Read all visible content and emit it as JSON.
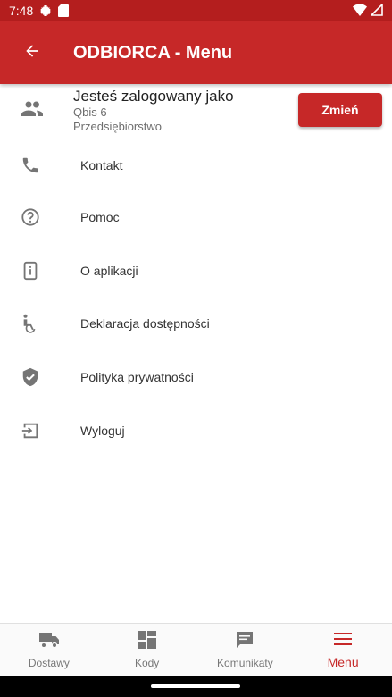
{
  "status_bar": {
    "time": "7:48",
    "icons": [
      "settings-icon",
      "sd-card-icon",
      "wifi-icon",
      "signal-icon"
    ]
  },
  "app_bar": {
    "title": "ODBIORCA - Menu",
    "back_icon": "arrow-back-icon"
  },
  "user": {
    "heading": "Jesteś zalogowany jako",
    "name": "Qbis 6",
    "type": "Przedsiębiorstwo",
    "change_button": "Zmień",
    "icon": "people-icon"
  },
  "menu": {
    "items": [
      {
        "label": "Kontakt",
        "icon": "phone-icon"
      },
      {
        "label": "Pomoc",
        "icon": "help-circle-icon"
      },
      {
        "label": "O aplikacji",
        "icon": "info-device-icon"
      },
      {
        "label": "Deklaracja dostępności",
        "icon": "accessibility-icon"
      },
      {
        "label": "Polityka prywatności",
        "icon": "shield-check-icon"
      },
      {
        "label": "Wyloguj",
        "icon": "logout-icon"
      }
    ]
  },
  "bottom_nav": {
    "items": [
      {
        "label": "Dostawy",
        "icon": "truck-icon"
      },
      {
        "label": "Kody",
        "icon": "dashboard-icon"
      },
      {
        "label": "Komunikaty",
        "icon": "message-icon"
      },
      {
        "label": "Menu",
        "icon": "menu-icon",
        "active": true
      }
    ]
  },
  "colors": {
    "primary": "#c62828",
    "status_bar": "#b41e1e",
    "icon_gray": "#757575"
  }
}
